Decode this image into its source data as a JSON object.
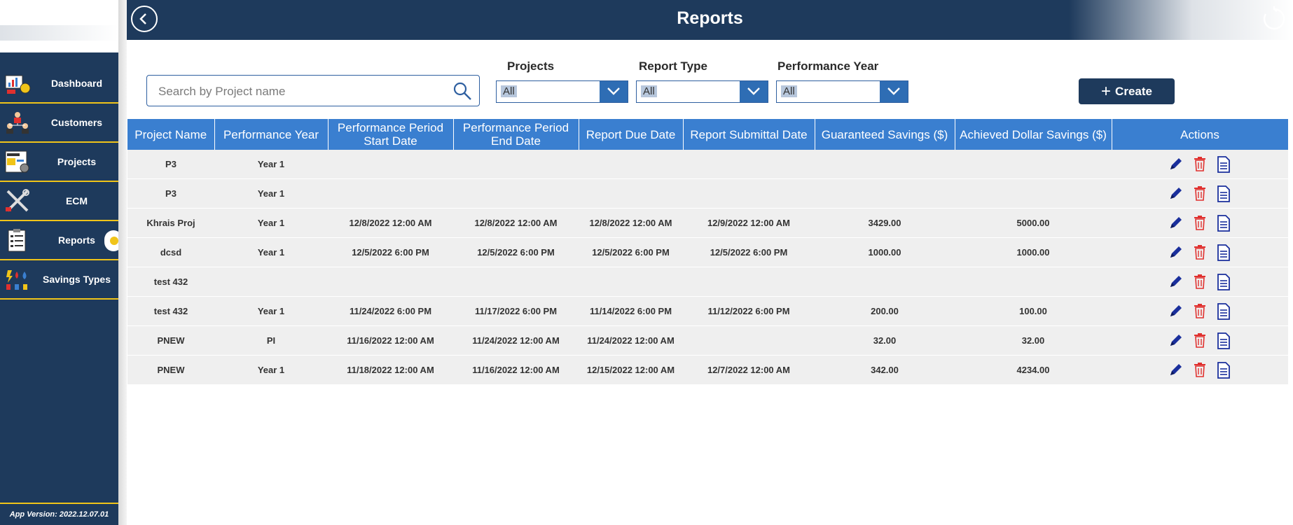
{
  "app": {
    "title": "Reports",
    "version": "App Version: 2022.12.07.01"
  },
  "sidebar": {
    "items": [
      {
        "label": "Dashboard",
        "icon": "dashboard-icon",
        "active": false
      },
      {
        "label": "Customers",
        "icon": "customers-icon",
        "active": false
      },
      {
        "label": "Projects",
        "icon": "projects-icon",
        "active": false
      },
      {
        "label": "ECM",
        "icon": "ecm-tools-icon",
        "active": false
      },
      {
        "label": "Reports",
        "icon": "reports-clipboard-icon",
        "active": true
      },
      {
        "label": "Savings Types",
        "icon": "savings-types-icon",
        "active": false
      }
    ]
  },
  "filters": {
    "search_placeholder": "Search by Project name",
    "projects": {
      "label": "Projects",
      "value": "All"
    },
    "report_type": {
      "label": "Report Type",
      "value": "All"
    },
    "performance_year": {
      "label": "Performance Year",
      "value": "All"
    },
    "create_label": "Create"
  },
  "table": {
    "headers": [
      "Project Name",
      "Performance Year",
      "Performance Period Start Date",
      "Performance Period End Date",
      "Report Due Date",
      "Report Submittal Date",
      "Guaranteed Savings ($)",
      "Achieved Dollar Savings ($)",
      "Actions"
    ],
    "rows": [
      [
        "P3",
        "Year 1",
        "",
        "",
        "",
        "",
        "",
        ""
      ],
      [
        "P3",
        "Year 1",
        "",
        "",
        "",
        "",
        "",
        ""
      ],
      [
        "Khrais Proj",
        "Year 1",
        "12/8/2022 12:00 AM",
        "12/8/2022 12:00 AM",
        "12/8/2022 12:00 AM",
        "12/9/2022 12:00 AM",
        "3429.00",
        "5000.00"
      ],
      [
        "dcsd",
        "Year 1",
        "12/5/2022 6:00 PM",
        "12/5/2022 6:00 PM",
        "12/5/2022 6:00 PM",
        "12/5/2022 6:00 PM",
        "1000.00",
        "1000.00"
      ],
      [
        "test 432",
        "",
        "",
        "",
        "",
        "",
        "",
        ""
      ],
      [
        "test 432",
        "Year 1",
        "11/24/2022 6:00 PM",
        "11/17/2022 6:00 PM",
        "11/14/2022 6:00 PM",
        "11/12/2022 6:00 PM",
        "200.00",
        "100.00"
      ],
      [
        "PNEW",
        "PI",
        "11/16/2022 12:00 AM",
        "11/24/2022 12:00 AM",
        "11/24/2022 12:00 AM",
        "",
        "32.00",
        "32.00"
      ],
      [
        "PNEW",
        "Year 1",
        "11/18/2022 12:00 AM",
        "11/16/2022 12:00 AM",
        "12/15/2022 12:00 AM",
        "12/7/2022 12:00 AM",
        "342.00",
        "4234.00"
      ]
    ]
  },
  "colors": {
    "navy": "#1e3a5c",
    "header_blue": "#3a7fd0",
    "accent_yellow": "#f0c419",
    "edit_icon": "#1a2f9c",
    "delete_icon": "#e0302e",
    "doc_icon": "#1a2f9c"
  }
}
